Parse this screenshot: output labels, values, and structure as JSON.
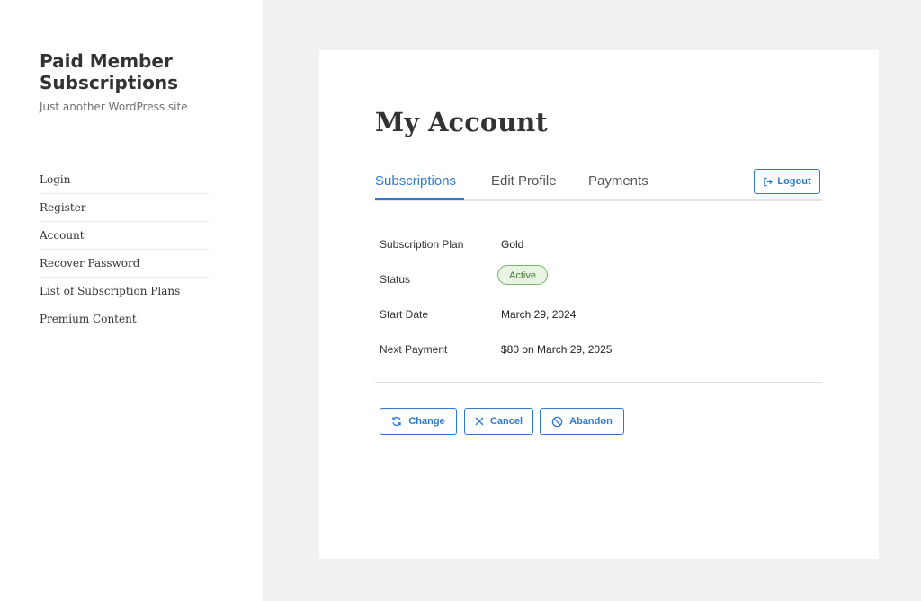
{
  "site": {
    "title": "Paid Member Subscriptions",
    "description": "Just another WordPress site"
  },
  "nav": {
    "items": [
      {
        "label": "Login"
      },
      {
        "label": "Register"
      },
      {
        "label": "Account"
      },
      {
        "label": "Recover Password"
      },
      {
        "label": "List of Subscription Plans"
      },
      {
        "label": "Premium Content"
      }
    ]
  },
  "account": {
    "title": "My Account",
    "tabs": [
      {
        "label": "Subscriptions",
        "active": true
      },
      {
        "label": "Edit Profile",
        "active": false
      },
      {
        "label": "Payments",
        "active": false
      }
    ],
    "logout_label": "Logout",
    "details": {
      "plan_label": "Subscription Plan",
      "plan_value": "Gold",
      "status_label": "Status",
      "status_value": "Active",
      "start_label": "Start Date",
      "start_value": "March 29, 2024",
      "next_label": "Next Payment",
      "next_value": "$80 on March 29, 2025"
    },
    "actions": {
      "change_label": "Change",
      "cancel_label": "Cancel",
      "abandon_label": "Abandon"
    }
  },
  "colors": {
    "accent": "#2d7bd0",
    "active_badge_bg": "#e8f3e3",
    "active_badge_border": "#7ab36a"
  },
  "icons": {
    "logout": "logout-icon",
    "change": "refresh-icon",
    "cancel": "close-icon",
    "abandon": "ban-icon"
  }
}
